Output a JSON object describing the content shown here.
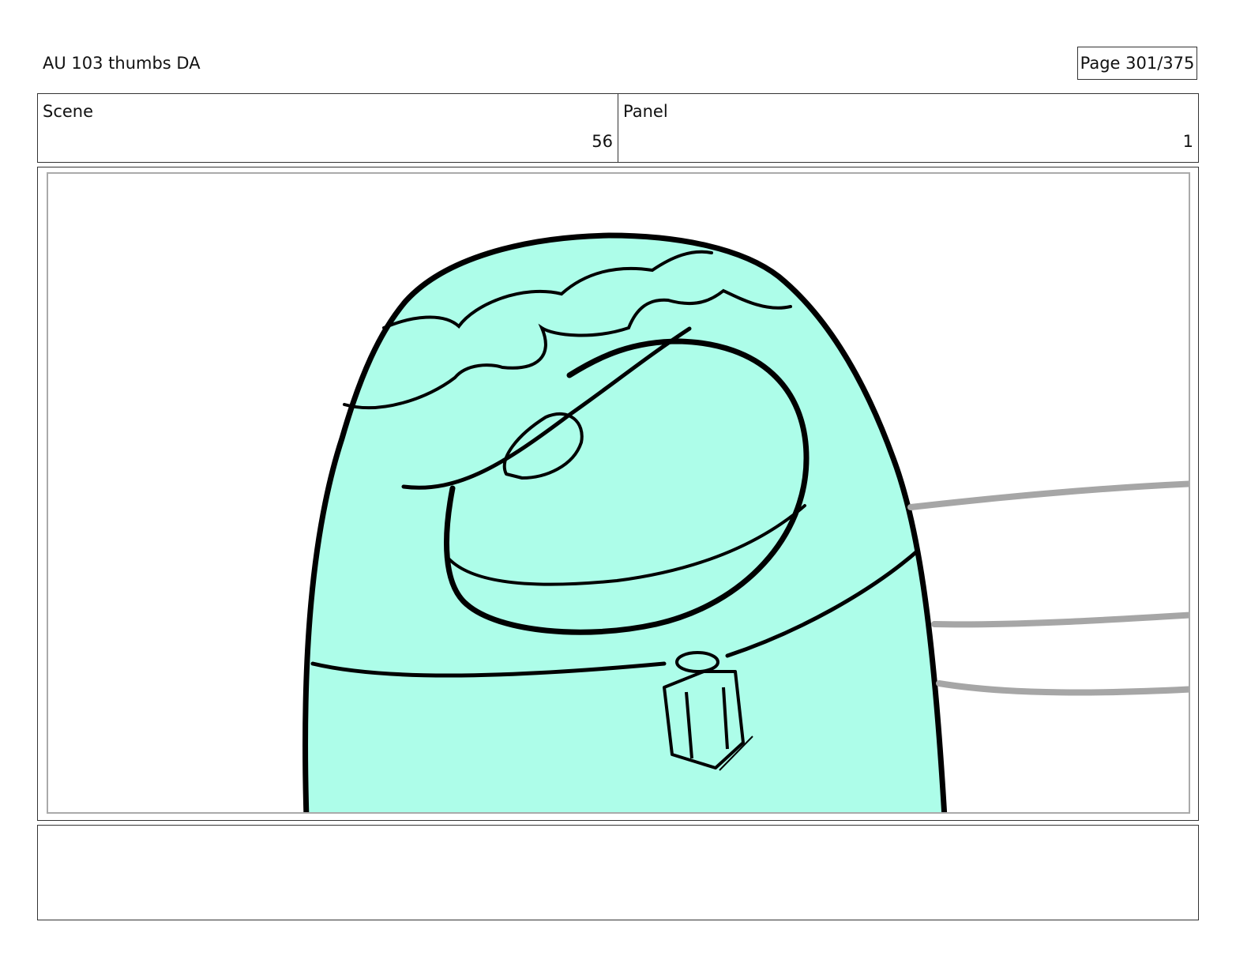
{
  "header": {
    "title": "AU 103 thumbs DA",
    "page_label": "Page 301/375"
  },
  "info": {
    "scene_label": "Scene",
    "scene_value": "56",
    "panel_label": "Panel",
    "panel_value": "1"
  },
  "drawing": {
    "subject": "crewmate-character-sketch",
    "body_color": "#adfde9",
    "outline_color": "#000000",
    "motion_line_color": "#a6a6a6"
  },
  "dialogue": {
    "text": ""
  }
}
